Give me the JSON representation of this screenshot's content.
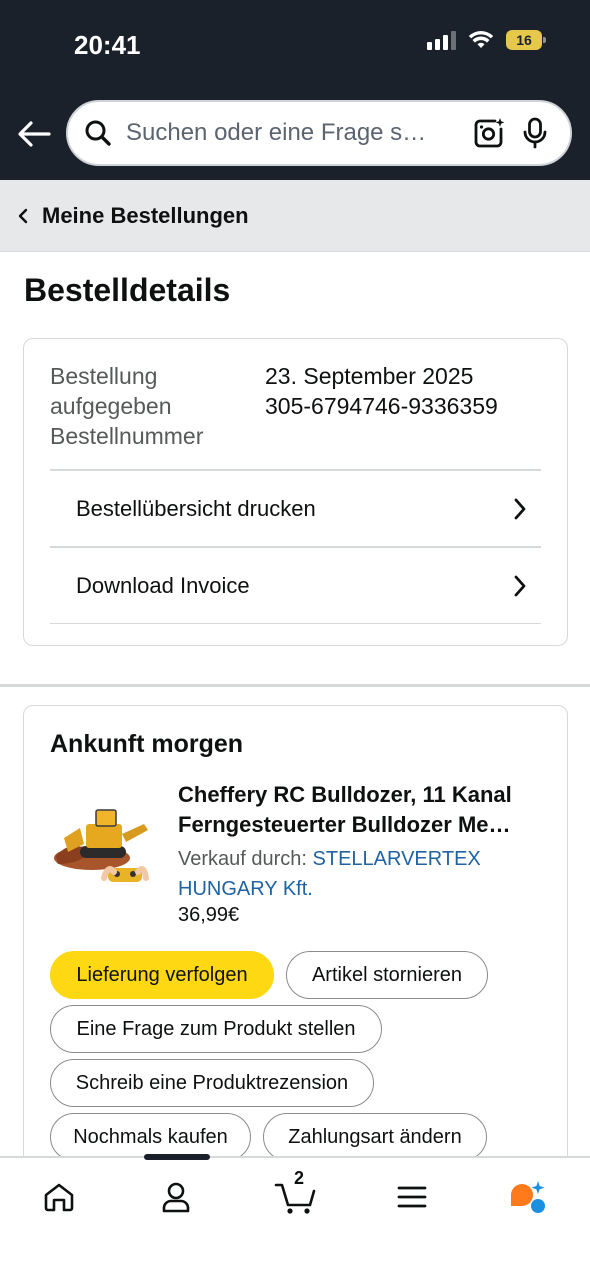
{
  "status_bar": {
    "time": "20:41",
    "battery": "16"
  },
  "search": {
    "placeholder": "Suchen oder eine Frage s…"
  },
  "breadcrumb": {
    "label": "Meine Bestellungen"
  },
  "page": {
    "title": "Bestelldetails"
  },
  "order": {
    "placed_label": "Bestellung aufgegeben",
    "number_label": "Bestellnummer",
    "date": "23. September 2025",
    "number": "305-6794746-9336359",
    "links": [
      {
        "label": "Bestellübersicht drucken"
      },
      {
        "label": "Download Invoice"
      }
    ]
  },
  "delivery": {
    "status": "Ankunft morgen",
    "product": {
      "title_line1": "Cheffery RC Bulldozer, 11 Kanal",
      "title_line2": "Ferngesteuerter Bulldozer Me…",
      "seller_label": "Verkauf durch:",
      "seller_name": "STELLARVERTEX HUNGARY Kft.",
      "price": "36,99€"
    },
    "buttons": {
      "track": "Lieferung verfolgen",
      "cancel": "Artikel stornieren",
      "question": "Eine Frage zum Produkt stellen",
      "review": "Schreib eine Produktrezension",
      "buy_again": "Nochmals kaufen",
      "payment": "Zahlungsart ändern"
    }
  },
  "bottom_nav": {
    "cart_count": "2",
    "icons": [
      "home-icon",
      "account-icon",
      "cart-icon",
      "menu-icon",
      "rufus-icon"
    ]
  },
  "colors": {
    "header_bg": "#1a212b",
    "primary_button": "#ffd814",
    "link": "#2162a1",
    "rufus_orange": "#ff7a1a",
    "rufus_blue": "#1b8fe0"
  }
}
